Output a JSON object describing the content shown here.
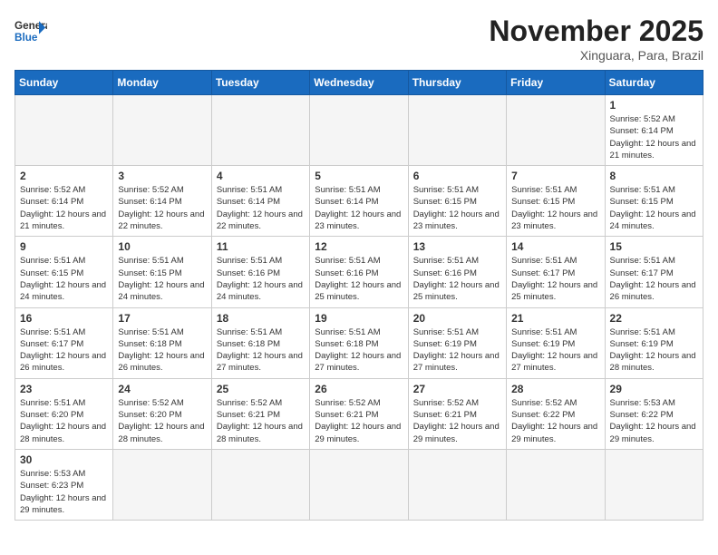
{
  "header": {
    "logo_general": "General",
    "logo_blue": "Blue",
    "month_title": "November 2025",
    "location": "Xinguara, Para, Brazil"
  },
  "weekdays": [
    "Sunday",
    "Monday",
    "Tuesday",
    "Wednesday",
    "Thursday",
    "Friday",
    "Saturday"
  ],
  "weeks": [
    [
      {
        "day": "",
        "info": ""
      },
      {
        "day": "",
        "info": ""
      },
      {
        "day": "",
        "info": ""
      },
      {
        "day": "",
        "info": ""
      },
      {
        "day": "",
        "info": ""
      },
      {
        "day": "",
        "info": ""
      },
      {
        "day": "1",
        "info": "Sunrise: 5:52 AM\nSunset: 6:14 PM\nDaylight: 12 hours and 21 minutes."
      }
    ],
    [
      {
        "day": "2",
        "info": "Sunrise: 5:52 AM\nSunset: 6:14 PM\nDaylight: 12 hours and 21 minutes."
      },
      {
        "day": "3",
        "info": "Sunrise: 5:52 AM\nSunset: 6:14 PM\nDaylight: 12 hours and 22 minutes."
      },
      {
        "day": "4",
        "info": "Sunrise: 5:51 AM\nSunset: 6:14 PM\nDaylight: 12 hours and 22 minutes."
      },
      {
        "day": "5",
        "info": "Sunrise: 5:51 AM\nSunset: 6:14 PM\nDaylight: 12 hours and 23 minutes."
      },
      {
        "day": "6",
        "info": "Sunrise: 5:51 AM\nSunset: 6:15 PM\nDaylight: 12 hours and 23 minutes."
      },
      {
        "day": "7",
        "info": "Sunrise: 5:51 AM\nSunset: 6:15 PM\nDaylight: 12 hours and 23 minutes."
      },
      {
        "day": "8",
        "info": "Sunrise: 5:51 AM\nSunset: 6:15 PM\nDaylight: 12 hours and 24 minutes."
      }
    ],
    [
      {
        "day": "9",
        "info": "Sunrise: 5:51 AM\nSunset: 6:15 PM\nDaylight: 12 hours and 24 minutes."
      },
      {
        "day": "10",
        "info": "Sunrise: 5:51 AM\nSunset: 6:15 PM\nDaylight: 12 hours and 24 minutes."
      },
      {
        "day": "11",
        "info": "Sunrise: 5:51 AM\nSunset: 6:16 PM\nDaylight: 12 hours and 24 minutes."
      },
      {
        "day": "12",
        "info": "Sunrise: 5:51 AM\nSunset: 6:16 PM\nDaylight: 12 hours and 25 minutes."
      },
      {
        "day": "13",
        "info": "Sunrise: 5:51 AM\nSunset: 6:16 PM\nDaylight: 12 hours and 25 minutes."
      },
      {
        "day": "14",
        "info": "Sunrise: 5:51 AM\nSunset: 6:17 PM\nDaylight: 12 hours and 25 minutes."
      },
      {
        "day": "15",
        "info": "Sunrise: 5:51 AM\nSunset: 6:17 PM\nDaylight: 12 hours and 26 minutes."
      }
    ],
    [
      {
        "day": "16",
        "info": "Sunrise: 5:51 AM\nSunset: 6:17 PM\nDaylight: 12 hours and 26 minutes."
      },
      {
        "day": "17",
        "info": "Sunrise: 5:51 AM\nSunset: 6:18 PM\nDaylight: 12 hours and 26 minutes."
      },
      {
        "day": "18",
        "info": "Sunrise: 5:51 AM\nSunset: 6:18 PM\nDaylight: 12 hours and 27 minutes."
      },
      {
        "day": "19",
        "info": "Sunrise: 5:51 AM\nSunset: 6:18 PM\nDaylight: 12 hours and 27 minutes."
      },
      {
        "day": "20",
        "info": "Sunrise: 5:51 AM\nSunset: 6:19 PM\nDaylight: 12 hours and 27 minutes."
      },
      {
        "day": "21",
        "info": "Sunrise: 5:51 AM\nSunset: 6:19 PM\nDaylight: 12 hours and 27 minutes."
      },
      {
        "day": "22",
        "info": "Sunrise: 5:51 AM\nSunset: 6:19 PM\nDaylight: 12 hours and 28 minutes."
      }
    ],
    [
      {
        "day": "23",
        "info": "Sunrise: 5:51 AM\nSunset: 6:20 PM\nDaylight: 12 hours and 28 minutes."
      },
      {
        "day": "24",
        "info": "Sunrise: 5:52 AM\nSunset: 6:20 PM\nDaylight: 12 hours and 28 minutes."
      },
      {
        "day": "25",
        "info": "Sunrise: 5:52 AM\nSunset: 6:21 PM\nDaylight: 12 hours and 28 minutes."
      },
      {
        "day": "26",
        "info": "Sunrise: 5:52 AM\nSunset: 6:21 PM\nDaylight: 12 hours and 29 minutes."
      },
      {
        "day": "27",
        "info": "Sunrise: 5:52 AM\nSunset: 6:21 PM\nDaylight: 12 hours and 29 minutes."
      },
      {
        "day": "28",
        "info": "Sunrise: 5:52 AM\nSunset: 6:22 PM\nDaylight: 12 hours and 29 minutes."
      },
      {
        "day": "29",
        "info": "Sunrise: 5:53 AM\nSunset: 6:22 PM\nDaylight: 12 hours and 29 minutes."
      }
    ],
    [
      {
        "day": "30",
        "info": "Sunrise: 5:53 AM\nSunset: 6:23 PM\nDaylight: 12 hours and 29 minutes."
      },
      {
        "day": "",
        "info": ""
      },
      {
        "day": "",
        "info": ""
      },
      {
        "day": "",
        "info": ""
      },
      {
        "day": "",
        "info": ""
      },
      {
        "day": "",
        "info": ""
      },
      {
        "day": "",
        "info": ""
      }
    ]
  ]
}
